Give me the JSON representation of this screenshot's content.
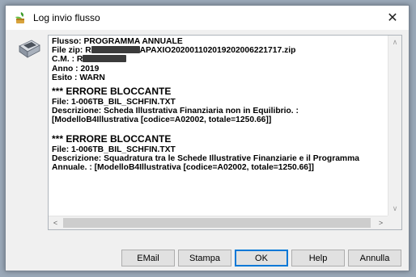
{
  "window": {
    "title": "Log invio flusso",
    "close_glyph": "✕"
  },
  "log": {
    "lines": [
      {
        "label": "Flusso: ",
        "value": "PROGRAMMA ANNUALE"
      },
      {
        "label": "File zip: R",
        "value": "APAXIO202001102019202006221717.zip"
      },
      {
        "label": "C.M. : R",
        "value": ""
      },
      {
        "label": "Anno : ",
        "value": "2019"
      },
      {
        "label": "Esito : ",
        "value": "WARN"
      }
    ],
    "errors": [
      {
        "title": "*** ERRORE BLOCCANTE",
        "file": "File: 1-006TB_BIL_SCHFIN.TXT",
        "desc1": "Descrizione: Scheda Illustrativa Finanziaria non in Equilibrio. :",
        "desc2": "[ModelloB4Illustrativa [codice=A02002, totale=1250.66]]"
      },
      {
        "title": "*** ERRORE BLOCCANTE",
        "file": "File: 1-006TB_BIL_SCHFIN.TXT",
        "desc1": "Descrizione: Squadratura tra le Schede Illustrative Finanziarie e il Programma",
        "desc2": "Annuale. : [ModelloB4Illustrativa [codice=A02002, totale=1250.66]]"
      }
    ]
  },
  "scrollbars": {
    "up": "∧",
    "down": "∨",
    "left": "<",
    "right": ">"
  },
  "buttons": {
    "email": "EMail",
    "print": "Stampa",
    "ok": "OK",
    "help": "Help",
    "cancel": "Annulla"
  },
  "colors": {
    "accent": "#0078d7",
    "text": "#000000",
    "background": "#f0f0f0"
  }
}
